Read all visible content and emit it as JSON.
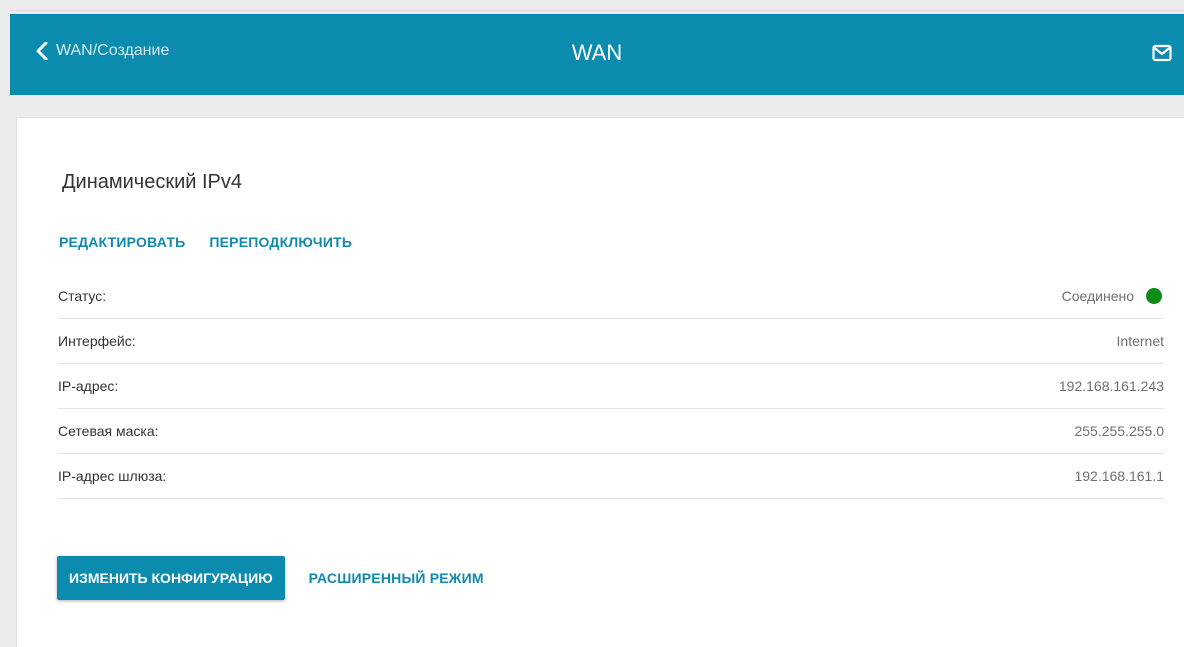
{
  "header": {
    "back_label": "WAN/Создание",
    "title": "WAN",
    "icons": {
      "back": "chevron-left-icon",
      "mail": "mail-icon"
    }
  },
  "main": {
    "section_title": "Динамический IPv4",
    "actions": {
      "edit": "РЕДАКТИРОВАТЬ",
      "reconnect": "ПЕРЕПОДКЛЮЧИТЬ"
    },
    "rows": [
      {
        "label": "Статус:",
        "value": "Соединено",
        "status_color": "#0e8a16"
      },
      {
        "label": "Интерфейс:",
        "value": "Internet"
      },
      {
        "label": "IP-адрес:",
        "value": "192.168.161.243"
      },
      {
        "label": "Сетевая маска:",
        "value": "255.255.255.0"
      },
      {
        "label": "IP-адрес шлюза:",
        "value": "192.168.161.1"
      }
    ],
    "bottom": {
      "change_config": "ИЗМЕНИТЬ КОНФИГУРАЦИЮ",
      "advanced_mode": "РАСШИРЕННЫЙ РЕЖИМ"
    }
  },
  "colors": {
    "accent": "#0b8bad",
    "link": "#1189ad",
    "status_ok": "#0e8a16"
  }
}
